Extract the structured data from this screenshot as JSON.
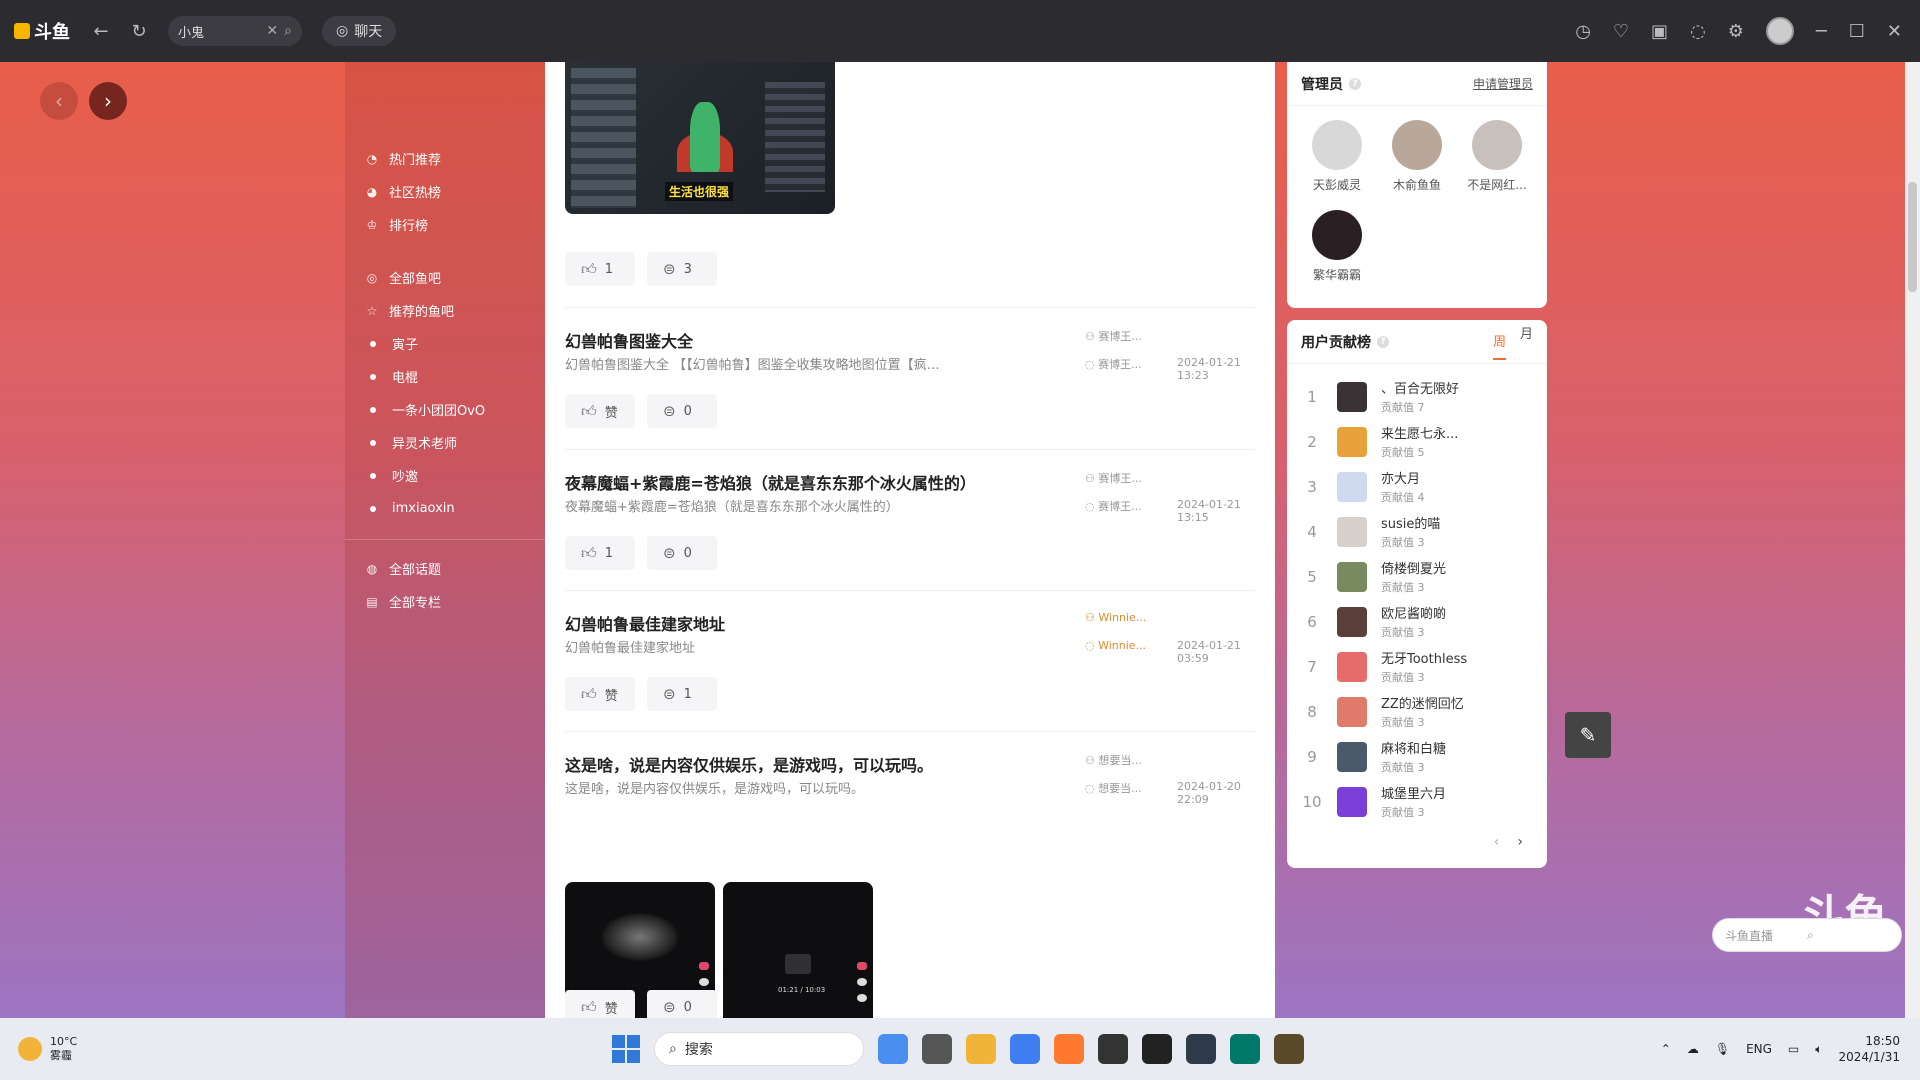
{
  "titlebar": {
    "logo": "斗鱼",
    "search_value": "小鬼",
    "chat_label": "聊天"
  },
  "sidebar": {
    "top": [
      {
        "label": "热门推荐",
        "icon": "fire-icon"
      },
      {
        "label": "社区热榜",
        "icon": "hot-list-icon"
      },
      {
        "label": "排行榜",
        "icon": "trophy-icon"
      }
    ],
    "groups": [
      {
        "label": "全部鱼吧",
        "icon": "fish-bar-icon"
      },
      {
        "label": "推荐的鱼吧",
        "icon": "star-icon"
      }
    ],
    "subs": [
      "寅子",
      "电棍",
      "一条小团团OvO",
      "异灵术老师",
      "吵邀",
      "imxiaoxin"
    ],
    "bottom": [
      {
        "label": "全部话题",
        "icon": "topic-icon"
      },
      {
        "label": "全部专栏",
        "icon": "column-icon"
      }
    ]
  },
  "main": {
    "top_thumb_caption": "生活也很强",
    "top_actions": {
      "like": "1",
      "comment": "3"
    },
    "posts": [
      {
        "title": "幻兽帕鲁图鉴大全",
        "desc": "幻兽帕鲁图鉴大全 【【幻兽帕鲁】图鉴全收集攻略地图位置【疯…",
        "author": "赛博王...",
        "replier": "赛博王...",
        "time": "2024-01-21 13:23",
        "like": "赞",
        "comment": "0"
      },
      {
        "title": "夜幕魔蝠+紫霞鹿=苍焰狼（就是喜东东那个冰火属性的）",
        "desc": "夜幕魔蝠+紫霞鹿=苍焰狼（就是喜东东那个冰火属性的）",
        "author": "赛博王...",
        "replier": "赛博王...",
        "time": "2024-01-21 13:15",
        "like": "1",
        "comment": "0"
      },
      {
        "title": "幻兽帕鲁最佳建家地址",
        "desc": "幻兽帕鲁最佳建家地址",
        "author": "Winnie...",
        "replier": "Winnie...",
        "time": "2024-01-21 03:59",
        "like": "赞",
        "comment": "1"
      },
      {
        "title": "这是啥，说是内容仅供娱乐，是游戏吗，可以玩吗。",
        "desc": "这是啥，说是内容仅供娱乐，是游戏吗，可以玩吗。",
        "author": "想要当...",
        "replier": "想要当...",
        "time": "2024-01-20 22:09",
        "like": "赞",
        "comment": "0"
      }
    ],
    "video_time": "01:21 / 10:03"
  },
  "admins_card": {
    "title": "管理员",
    "apply_label": "申请管理员",
    "admins": [
      {
        "name": "天彭威灵",
        "color": "#d8d8d8"
      },
      {
        "name": "木俞鱼鱼",
        "color": "#b9a79a"
      },
      {
        "name": "不是网红...",
        "color": "#c8c0bc"
      },
      {
        "name": "繁华霸霸",
        "color": "#2a1f22"
      }
    ]
  },
  "rank_card": {
    "title": "用户贡献榜",
    "tab_week": "周",
    "tab_month": "月",
    "score_label": "贡献值",
    "ranks": [
      {
        "num": "1",
        "name": "、百合无限好",
        "score": "7",
        "color": "#3a3235"
      },
      {
        "num": "2",
        "name": "来生愿七永...",
        "score": "5",
        "color": "#e8a23c"
      },
      {
        "num": "3",
        "name": "亦大月",
        "score": "4",
        "color": "#cfd9ef"
      },
      {
        "num": "4",
        "name": "susie的喵",
        "score": "3",
        "color": "#d6d1cb"
      },
      {
        "num": "5",
        "name": "倚楼倒夏光",
        "score": "3",
        "color": "#7a8a5f"
      },
      {
        "num": "6",
        "name": "欧尼酱啲啲",
        "score": "3",
        "color": "#5a3f3a"
      },
      {
        "num": "7",
        "name": "无牙Toothless",
        "score": "3",
        "color": "#e66b6b"
      },
      {
        "num": "8",
        "name": "ZZ的迷惘回忆",
        "score": "3",
        "color": "#e07a6a"
      },
      {
        "num": "9",
        "name": "麻将和白糖",
        "score": "3",
        "color": "#4a5a6a"
      },
      {
        "num": "10",
        "name": "城堡里六月",
        "score": "3",
        "color": "#7b3fd8"
      }
    ]
  },
  "mini_search_placeholder": "斗鱼直播",
  "watermark": "斗鱼",
  "taskbar": {
    "temp": "10°C",
    "weather": "雾霾",
    "search_label": "搜索",
    "lang": "ENG",
    "time": "18:50",
    "date": "2024/1/31",
    "apps": [
      "#4a8ef0",
      "#555",
      "#f0b43a",
      "#3f7ef0",
      "#ff7a2f",
      "#333",
      "#222",
      "#2e3a4a",
      "#00796b",
      "#5a4a2a"
    ]
  }
}
